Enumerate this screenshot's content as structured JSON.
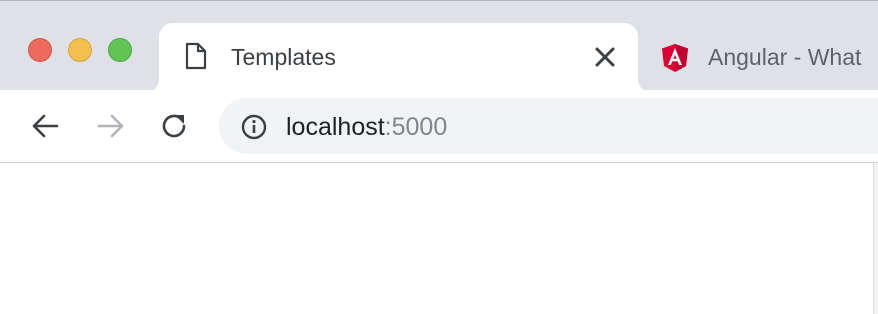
{
  "window": {
    "traffic_lights": [
      "close",
      "minimize",
      "maximize"
    ],
    "colors": {
      "close": "#ed6a5e",
      "minimize": "#f5bf4f",
      "maximize": "#61c554"
    }
  },
  "tabs": [
    {
      "title": "Templates",
      "icon": "document-icon",
      "active": true,
      "close_label": "×"
    },
    {
      "title": "Angular - What",
      "icon": "angular-icon",
      "active": false
    }
  ],
  "toolbar": {
    "back_icon": "arrow-left-icon",
    "forward_icon": "arrow-right-icon",
    "reload_icon": "reload-icon"
  },
  "address_bar": {
    "info_icon": "info-icon",
    "host": "localhost",
    "port": ":5000"
  }
}
